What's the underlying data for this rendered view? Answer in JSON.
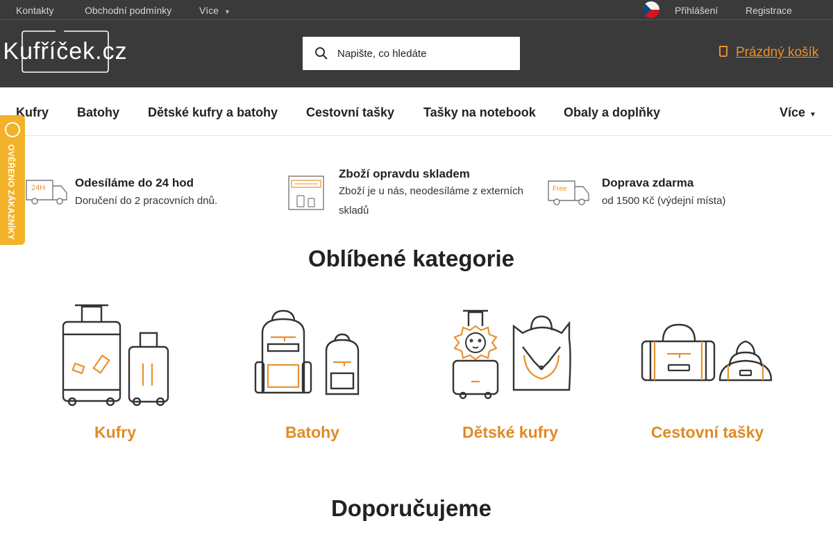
{
  "topbar": {
    "links": [
      "Kontakty",
      "Obchodní podmínky",
      "Více"
    ],
    "login": "Přihlášení",
    "register": "Registrace"
  },
  "header": {
    "logo_text": "Kufříček.cz",
    "search_placeholder": "Napište, co hledáte",
    "cart_label": "Prázdný košík"
  },
  "nav": {
    "items": [
      "Kufry",
      "Batohy",
      "Dětské kufry a batohy",
      "Cestovní tašky",
      "Tašky na notebook",
      "Obaly a doplňky"
    ],
    "more": "Více"
  },
  "badge": {
    "text": "OVĚŘENO ZÁKAZNÍKY"
  },
  "features": [
    {
      "icon_text": "24H",
      "title": "Odesíláme do 24 hod",
      "desc": "Doručení do 2 pracovních dnů."
    },
    {
      "title": "Zboží opravdu skladem",
      "desc": "Zboží je u nás, neodesíláme z externích skladů"
    },
    {
      "icon_text": "Free",
      "title": "Doprava zdarma",
      "desc": "od 1500 Kč (výdejní místa)"
    }
  ],
  "categories_heading": "Oblíbené kategorie",
  "categories": [
    "Kufry",
    "Batohy",
    "Dětské kufry",
    "Cestovní tašky"
  ],
  "recommend_heading": "Doporučujeme",
  "colors": {
    "header_bg": "#3a3a3a",
    "accent": "#e8912c",
    "badge": "#f2b229"
  }
}
